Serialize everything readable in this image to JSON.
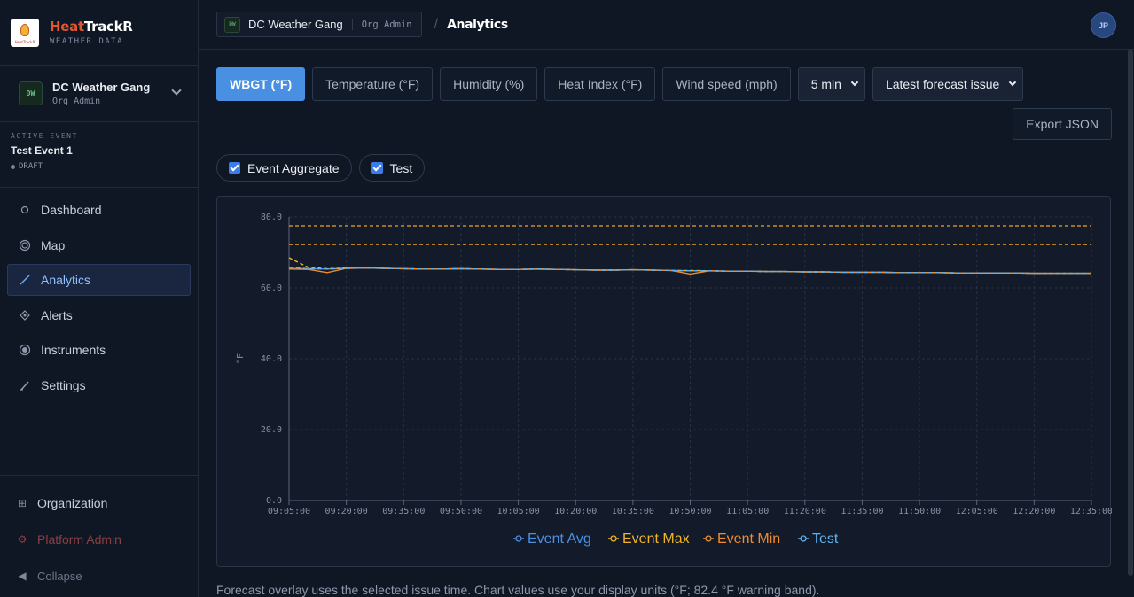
{
  "brand": {
    "name_part1": "Heat",
    "name_part2": "TrackR",
    "subtitle": "WEATHER DATA",
    "logo_text": "HeatTrackR"
  },
  "org": {
    "badge": "DW",
    "name": "DC Weather Gang",
    "role": "Org Admin"
  },
  "event": {
    "label": "ACTIVE EVENT",
    "name": "Test Event 1",
    "status": "DRAFT"
  },
  "nav": [
    {
      "label": "Dashboard",
      "icon": "dashboard-icon"
    },
    {
      "label": "Map",
      "icon": "map-icon"
    },
    {
      "label": "Analytics",
      "icon": "analytics-icon"
    },
    {
      "label": "Alerts",
      "icon": "alerts-icon"
    },
    {
      "label": "Instruments",
      "icon": "instruments-icon"
    },
    {
      "label": "Settings",
      "icon": "settings-icon"
    }
  ],
  "bottom_nav": {
    "organization": "Organization",
    "platform_admin": "Platform Admin",
    "collapse": "Collapse"
  },
  "topbar": {
    "org_badge": "DW",
    "org_name": "DC Weather Gang",
    "org_role": "Org Admin",
    "separator": "/",
    "page": "Analytics",
    "avatar": "JP"
  },
  "metrics": [
    {
      "label": "WBGT (°F)",
      "active": true
    },
    {
      "label": "Temperature (°F)",
      "active": false
    },
    {
      "label": "Humidity (%)",
      "active": false
    },
    {
      "label": "Heat Index (°F)",
      "active": false
    },
    {
      "label": "Wind speed (mph)",
      "active": false
    }
  ],
  "interval_select": {
    "value": "5 min"
  },
  "forecast_select": {
    "value": "Latest forecast issue"
  },
  "export_label": "Export JSON",
  "series_toggles": [
    {
      "label": "Event Aggregate",
      "checked": true
    },
    {
      "label": "Test",
      "checked": true
    }
  ],
  "footnote": "Forecast overlay uses the selected issue time. Chart values use your display units (°F; 82.4 °F warning band).",
  "colors": {
    "accent": "#4a90e2",
    "event_avg": "#4a90e2",
    "event_max": "#f0b429",
    "event_min": "#f08c2a",
    "test": "#5fb3f0",
    "brand_heat": "#e2552d"
  },
  "chart_data": {
    "type": "line",
    "ylabel": "°F",
    "ylim": [
      0,
      80
    ],
    "yticks": [
      "0.0",
      "20.0",
      "40.0",
      "60.0",
      "80.0"
    ],
    "xticks": [
      "09:05:00",
      "09:20:00",
      "09:35:00",
      "09:50:00",
      "10:05:00",
      "10:20:00",
      "10:35:00",
      "10:50:00",
      "11:05:00",
      "11:20:00",
      "11:35:00",
      "11:50:00",
      "12:05:00",
      "12:20:00",
      "12:35:00"
    ],
    "x": [
      "09:05",
      "09:10",
      "09:15",
      "09:20",
      "09:25",
      "09:30",
      "09:35",
      "09:40",
      "09:45",
      "09:50",
      "09:55",
      "10:00",
      "10:05",
      "10:10",
      "10:15",
      "10:20",
      "10:25",
      "10:30",
      "10:35",
      "10:40",
      "10:45",
      "10:50",
      "10:55",
      "11:00",
      "11:05",
      "11:10",
      "11:15",
      "11:20",
      "11:25",
      "11:30",
      "11:35",
      "11:40",
      "11:45",
      "11:50",
      "11:55",
      "12:00",
      "12:05",
      "12:10",
      "12:15",
      "12:20",
      "12:25",
      "12:30",
      "12:35"
    ],
    "reference_lines": [
      77.5,
      72.2
    ],
    "grid": true,
    "legend_position": "bottom",
    "series": [
      {
        "name": "Event Avg",
        "values": [
          65.5,
          65.4,
          65.3,
          65.5,
          65.6,
          65.5,
          65.4,
          65.3,
          65.3,
          65.4,
          65.3,
          65.2,
          65.2,
          65.3,
          65.2,
          65.1,
          65.0,
          65.0,
          65.1,
          65.0,
          64.9,
          64.8,
          64.8,
          64.7,
          64.7,
          64.6,
          64.6,
          64.5,
          64.5,
          64.4,
          64.4,
          64.4,
          64.3,
          64.3,
          64.3,
          64.2,
          64.2,
          64.2,
          64.2,
          64.1,
          64.1,
          64.1,
          64.1
        ]
      },
      {
        "name": "Event Max",
        "values": [
          68.5,
          65.8,
          65.4,
          65.6,
          65.6,
          65.5,
          65.4,
          65.3,
          65.3,
          65.4,
          65.3,
          65.2,
          65.2,
          65.3,
          65.2,
          65.1,
          65.0,
          65.0,
          65.1,
          65.0,
          64.9,
          64.9,
          64.8,
          64.7,
          64.7,
          64.6,
          64.6,
          64.5,
          64.5,
          64.4,
          64.4,
          64.4,
          64.3,
          64.3,
          64.3,
          64.2,
          64.2,
          64.2,
          64.2,
          64.1,
          64.1,
          64.1,
          64.1
        ]
      },
      {
        "name": "Event Min",
        "values": [
          65.3,
          65.2,
          64.3,
          65.5,
          65.6,
          65.5,
          65.4,
          65.3,
          65.3,
          65.4,
          65.3,
          65.2,
          65.2,
          65.3,
          65.2,
          65.1,
          65.0,
          65.0,
          65.1,
          65.0,
          64.9,
          63.9,
          64.8,
          64.7,
          64.7,
          64.6,
          64.6,
          64.5,
          64.5,
          64.4,
          64.4,
          64.4,
          64.3,
          64.3,
          64.3,
          64.2,
          64.2,
          64.2,
          64.2,
          64.1,
          64.1,
          64.1,
          64.1
        ]
      },
      {
        "name": "Test",
        "values": [
          65.8,
          65.4,
          65.3,
          65.5,
          65.6,
          65.5,
          65.4,
          65.3,
          65.3,
          65.4,
          65.3,
          65.2,
          65.2,
          65.3,
          65.2,
          65.1,
          65.0,
          65.0,
          65.1,
          65.0,
          64.9,
          64.8,
          64.8,
          64.7,
          64.7,
          64.6,
          64.6,
          64.5,
          64.5,
          64.4,
          64.4,
          64.4,
          64.3,
          64.3,
          64.3,
          64.2,
          64.2,
          64.2,
          64.2,
          64.1,
          64.1,
          64.1,
          64.1
        ]
      }
    ]
  }
}
